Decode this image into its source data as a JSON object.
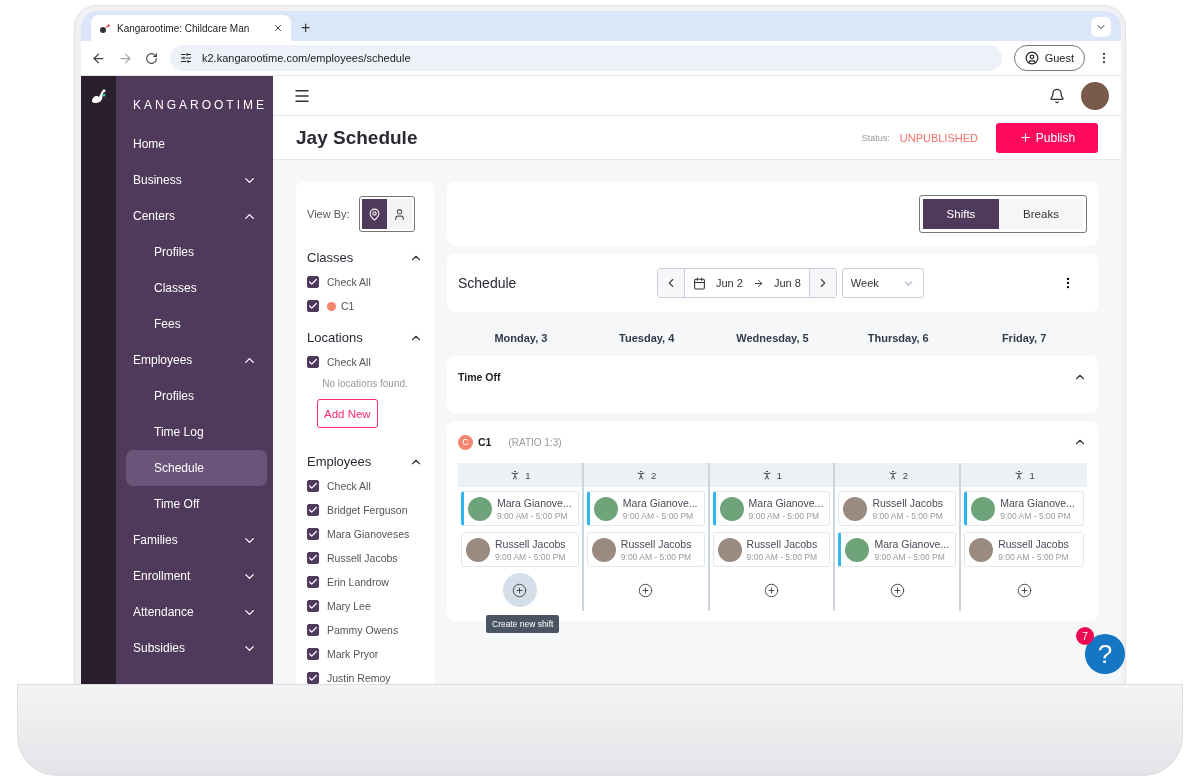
{
  "browser": {
    "tab_title": "Kangarootime: Childcare Man",
    "new_tab": "+",
    "url": "k2.kangarootime.com/employees/schedule",
    "profile": "Guest"
  },
  "sidebar": {
    "brand": "KANGAROOTIME",
    "items": [
      {
        "label": "Home",
        "selected": false
      },
      {
        "label": "Business",
        "expanded": false,
        "selected": false
      },
      {
        "label": "Centers",
        "expanded": true,
        "selected": false,
        "children": [
          {
            "label": "Profiles",
            "selected": false
          },
          {
            "label": "Classes",
            "selected": false
          },
          {
            "label": "Fees",
            "selected": false
          }
        ]
      },
      {
        "label": "Employees",
        "expanded": true,
        "selected": false,
        "children": [
          {
            "label": "Profiles",
            "selected": false
          },
          {
            "label": "Time Log",
            "selected": false
          },
          {
            "label": "Schedule",
            "selected": true
          },
          {
            "label": "Time Off",
            "selected": false
          }
        ]
      },
      {
        "label": "Families",
        "expanded": false,
        "selected": false
      },
      {
        "label": "Enrollment",
        "expanded": false,
        "selected": false
      },
      {
        "label": "Attendance",
        "expanded": false,
        "selected": false
      },
      {
        "label": "Subsidies",
        "expanded": false,
        "selected": false
      }
    ]
  },
  "header": {
    "title": "Jay Schedule",
    "status_label": "Status:",
    "status": "UNPUBLISHED",
    "publish": "Publish",
    "notifications": true
  },
  "filters": {
    "view_by": "View By:",
    "view_options": [
      {
        "kind": "location",
        "selected": true
      },
      {
        "kind": "person",
        "selected": false
      }
    ],
    "sections": [
      {
        "title": "Classes",
        "expanded": true,
        "items": [
          {
            "label": "Check All",
            "checked": true
          },
          {
            "label": "C1",
            "checked": true,
            "color": "#f4846e"
          }
        ]
      },
      {
        "title": "Locations",
        "expanded": true,
        "items": [
          {
            "label": "Check All",
            "checked": true
          }
        ],
        "empty": "No locations found.",
        "button": "Add New"
      },
      {
        "title": "Employees",
        "expanded": true,
        "items": [
          {
            "label": "Check All",
            "checked": true
          },
          {
            "label": "Bridget Ferguson",
            "checked": true
          },
          {
            "label": "Mara Gianoveses",
            "checked": true
          },
          {
            "label": "Russell Jacobs",
            "checked": true
          },
          {
            "label": "Erin Landrow",
            "checked": true
          },
          {
            "label": "Mary Lee",
            "checked": true
          },
          {
            "label": "Pammy Owens",
            "checked": true
          },
          {
            "label": "Mark Pryor",
            "checked": true
          },
          {
            "label": "Justin Remoy",
            "checked": true
          }
        ]
      }
    ]
  },
  "mode_toggle": [
    {
      "label": "Shifts",
      "selected": true
    },
    {
      "label": "Breaks",
      "selected": false
    }
  ],
  "schedule": {
    "title": "Schedule",
    "start": "Jun 2",
    "end": "Jun 8",
    "period": "Week"
  },
  "days": [
    "Monday, 3",
    "Tuesday, 4",
    "Wednesday, 5",
    "Thursday, 6",
    "Friday, 7"
  ],
  "time_off": {
    "title": "Time Off",
    "expanded": true
  },
  "class_group": {
    "badge": "C",
    "name": "C1",
    "ratio": "(RATIO 1:3)",
    "color": "#f4846e",
    "expanded": true,
    "columns": [
      {
        "count": "1",
        "shifts": [
          {
            "name": "Mara Gianove...",
            "time": "9:00 AM - 5:00 PM",
            "flagged": true
          },
          {
            "name": "Russell Jacobs",
            "time": "9:00 AM - 5:00 PM",
            "flagged": false
          }
        ],
        "hovered": true
      },
      {
        "count": "2",
        "shifts": [
          {
            "name": "Mara Gianove...",
            "time": "9:00 AM - 5:00 PM",
            "flagged": true
          },
          {
            "name": "Russell Jacobs",
            "time": "9:00 AM - 5:00 PM",
            "flagged": false
          }
        ],
        "hovered": false
      },
      {
        "count": "1",
        "shifts": [
          {
            "name": "Mara Gianove...",
            "time": "9:00 AM - 5:00 PM",
            "flagged": true
          },
          {
            "name": "Russell Jacobs",
            "time": "9:00 AM - 5:00 PM",
            "flagged": false
          }
        ],
        "hovered": false
      },
      {
        "count": "2",
        "shifts": [
          {
            "name": "Russell Jacobs",
            "time": "9:00 AM - 5:00 PM",
            "flagged": false
          },
          {
            "name": "Mara Gianove...",
            "time": "9:00 AM - 5:00 PM",
            "flagged": true
          }
        ],
        "hovered": false
      },
      {
        "count": "1",
        "shifts": [
          {
            "name": "Mara Gianove...",
            "time": "9:00 AM - 5:00 PM",
            "flagged": true
          },
          {
            "name": "Russell Jacobs",
            "time": "9:00 AM - 5:00 PM",
            "flagged": false
          }
        ],
        "hovered": false
      }
    ]
  },
  "tooltip": "Create new shift",
  "help": {
    "badge": "7",
    "label": "?"
  }
}
